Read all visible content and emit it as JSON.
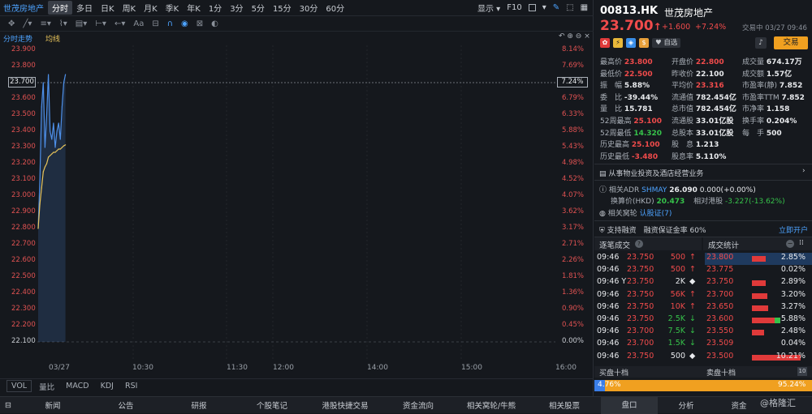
{
  "topbar": {
    "stock_name": "世茂房地产",
    "tabs": [
      "分时",
      "多日",
      "日K",
      "周K",
      "月K",
      "季K",
      "年K",
      "1分",
      "3分",
      "5分",
      "15分",
      "30分",
      "60分"
    ],
    "active_tab": "分时",
    "display_label": "显示",
    "f10_label": "F10"
  },
  "chart": {
    "header_left": "分时走势",
    "header_avg": "均线",
    "current_price_tag": "23.700",
    "current_pct_tag": "7.24%",
    "y_left": [
      "23.900",
      "23.800",
      "23.700",
      "23.600",
      "23.500",
      "23.400",
      "23.300",
      "23.200",
      "23.100",
      "23.000",
      "22.900",
      "22.800",
      "22.700",
      "22.600",
      "22.500",
      "22.400",
      "22.300",
      "22.200",
      "22.100"
    ],
    "y_right": [
      "8.14%",
      "7.69%",
      "7.24%",
      "6.79%",
      "6.33%",
      "5.88%",
      "5.43%",
      "4.98%",
      "4.52%",
      "4.07%",
      "3.62%",
      "3.17%",
      "2.71%",
      "2.26%",
      "1.81%",
      "1.36%",
      "0.90%",
      "0.45%",
      "0.00%"
    ],
    "x_labels": [
      "03/27",
      "10:30",
      "11:30",
      "12:00",
      "14:00",
      "15:00",
      "16:00"
    ]
  },
  "chart_data": {
    "type": "line",
    "series": [
      {
        "name": "分时",
        "x": [
          "09:30",
          "09:31",
          "09:32",
          "09:33",
          "09:34",
          "09:35",
          "09:36",
          "09:37",
          "09:38",
          "09:39",
          "09:40",
          "09:41",
          "09:42",
          "09:43",
          "09:44",
          "09:45",
          "09:46"
        ],
        "values": [
          22.8,
          23.1,
          23.55,
          23.7,
          23.3,
          23.5,
          23.75,
          23.4,
          23.35,
          23.45,
          23.3,
          23.4,
          23.45,
          23.35,
          23.55,
          23.7,
          23.75
        ]
      },
      {
        "name": "均线",
        "x": [
          "09:30",
          "09:31",
          "09:32",
          "09:33",
          "09:34",
          "09:35",
          "09:36",
          "09:37",
          "09:38",
          "09:39",
          "09:40",
          "09:41",
          "09:42",
          "09:43",
          "09:44",
          "09:45",
          "09:46"
        ],
        "values": [
          22.8,
          22.95,
          23.05,
          23.15,
          23.18,
          23.2,
          23.24,
          23.25,
          23.26,
          23.27,
          23.27,
          23.28,
          23.29,
          23.29,
          23.3,
          23.31,
          23.316
        ]
      }
    ],
    "ylim": [
      22.1,
      23.9
    ]
  },
  "indicators": [
    "VOL",
    "量比",
    "MACD",
    "KDJ",
    "RSI"
  ],
  "quote": {
    "code": "00813.HK",
    "name": "世茂房地产",
    "price": "23.700",
    "arrow": "↑",
    "change": "+1.600",
    "change_pct": "+7.24%",
    "status": "交易中 03/27 09:46",
    "watch_label": "自选",
    "trade_label": "交易"
  },
  "stats": [
    {
      "k": "最高价",
      "v": "23.800",
      "c": "red"
    },
    {
      "k": "开盘价",
      "v": "22.800",
      "c": "red"
    },
    {
      "k": "成交量",
      "v": "674.17万",
      "c": "white"
    },
    {
      "k": "最低价",
      "v": "22.500",
      "c": "red"
    },
    {
      "k": "昨收价",
      "v": "22.100",
      "c": "white"
    },
    {
      "k": "成交额",
      "v": "1.57亿",
      "c": "white"
    },
    {
      "k": "振　幅",
      "v": "5.88%",
      "c": "white"
    },
    {
      "k": "平均价",
      "v": "23.316",
      "c": "red"
    },
    {
      "k": "市盈率(静)",
      "v": "7.852",
      "c": "white"
    },
    {
      "k": "委　比",
      "v": "-39.44%",
      "c": "white"
    },
    {
      "k": "流通值",
      "v": "782.454亿",
      "c": "white"
    },
    {
      "k": "市盈率TTM",
      "v": "7.852",
      "c": "white"
    },
    {
      "k": "量　比",
      "v": "15.781",
      "c": "white"
    },
    {
      "k": "总市值",
      "v": "782.454亿",
      "c": "white"
    },
    {
      "k": "市净率",
      "v": "1.158",
      "c": "white"
    },
    {
      "k": "52周最高",
      "v": "25.100",
      "c": "red"
    },
    {
      "k": "流通股",
      "v": "33.01亿股",
      "c": "white"
    },
    {
      "k": "换手率",
      "v": "0.204%",
      "c": "white"
    },
    {
      "k": "52周最低",
      "v": "14.320",
      "c": "green"
    },
    {
      "k": "总股本",
      "v": "33.01亿股",
      "c": "white"
    },
    {
      "k": "每　手",
      "v": "500",
      "c": "white"
    },
    {
      "k": "历史最高",
      "v": "25.100",
      "c": "red"
    },
    {
      "k": "股　息",
      "v": "1.213",
      "c": "white"
    },
    {
      "k": "",
      "v": "",
      "c": "white"
    },
    {
      "k": "历史最低",
      "v": "-3.480",
      "c": "red"
    },
    {
      "k": "股息率",
      "v": "5.110%",
      "c": "white"
    },
    {
      "k": "",
      "v": "",
      "c": "white"
    }
  ],
  "business": "从事物业投资及酒店经营业务",
  "adr": {
    "label": "相关ADR",
    "ticker": "SHMAY",
    "price": "26.090",
    "change": "0.000(+0.00%)",
    "conv_label": "换算价(HKD)",
    "conv_value": "20.473",
    "premium_label": "相对港股",
    "premium_value": "-3.227(-13.62%)"
  },
  "warrants": {
    "label": "相关窝轮",
    "link": "认股证(7)"
  },
  "margin": {
    "text": "支持融资　融资保证金率 60%",
    "open": "立即开户"
  },
  "trades_title": "逐笔成交",
  "dist_title": "成交统计",
  "trades": [
    {
      "t": "09:46",
      "p": "23.750",
      "v": "500",
      "d": "↑",
      "c": "red"
    },
    {
      "t": "09:46",
      "p": "23.750",
      "v": "500",
      "d": "↑",
      "c": "red"
    },
    {
      "t": "09:46 Y",
      "p": "23.750",
      "v": "2K",
      "d": "◆",
      "c": "white"
    },
    {
      "t": "09:46",
      "p": "23.750",
      "v": "56K",
      "d": "↑",
      "c": "red"
    },
    {
      "t": "09:46",
      "p": "23.750",
      "v": "10K",
      "d": "↑",
      "c": "red"
    },
    {
      "t": "09:46",
      "p": "23.750",
      "v": "2.5K",
      "d": "↓",
      "c": "green"
    },
    {
      "t": "09:46",
      "p": "23.700",
      "v": "7.5K",
      "d": "↓",
      "c": "green"
    },
    {
      "t": "09:46",
      "p": "23.700",
      "v": "1.5K",
      "d": "↓",
      "c": "green"
    },
    {
      "t": "09:46",
      "p": "23.750",
      "v": "500",
      "d": "◆",
      "c": "white"
    }
  ],
  "distribution": [
    {
      "p": "23.800",
      "pct": "2.85%",
      "fill": 0.29
    },
    {
      "p": "23.775",
      "pct": "0.02%",
      "fill": 0.0
    },
    {
      "p": "23.750",
      "pct": "2.89%",
      "fill": 0.29
    },
    {
      "p": "23.700",
      "pct": "3.20%",
      "fill": 0.32
    },
    {
      "p": "23.650",
      "pct": "3.27%",
      "fill": 0.33
    },
    {
      "p": "23.600",
      "pct": "5.88%",
      "fill": 0.58
    },
    {
      "p": "23.550",
      "pct": "2.48%",
      "fill": 0.25
    },
    {
      "p": "23.509",
      "pct": "0.04%",
      "fill": 0.0
    },
    {
      "p": "23.500",
      "pct": "10.21%",
      "fill": 1.0
    }
  ],
  "book": {
    "buy_label": "买盘十档",
    "sell_label": "卖盘十档",
    "buy_pct": "4.76%",
    "sell_pct": "95.24%",
    "buy_fill": 0.0476
  },
  "bottom_nav": [
    "新闻",
    "公告",
    "研报",
    "个股笔记",
    "港股快捷交易",
    "资金流向",
    "相关窝轮/牛熊",
    "相关股票"
  ],
  "right_tabs": [
    "盘口",
    "分析",
    "资金"
  ],
  "watermark": "@格隆汇",
  "colors": {
    "up": "#f04b4b",
    "down": "#36c24a",
    "line": "#4d8fe8",
    "avg": "#e8c45a"
  }
}
